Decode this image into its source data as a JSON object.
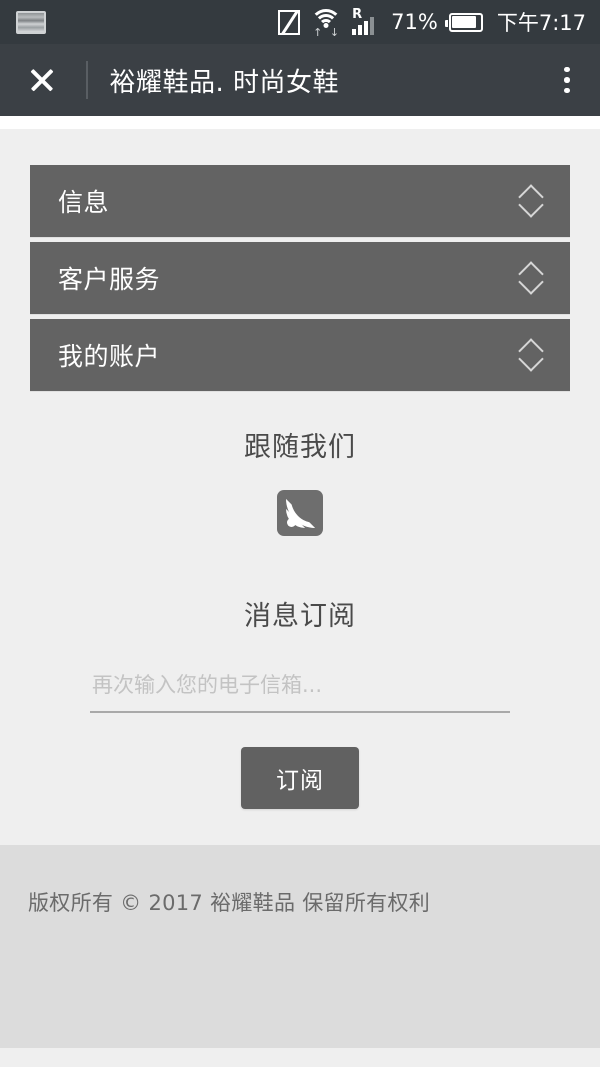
{
  "status_bar": {
    "left_icons": [
      {
        "name": "screenshot-notification-icon"
      }
    ],
    "nfc_icon": "nfc-icon",
    "wifi_icon": "wifi-icon",
    "wifi_up_arrow": "↑",
    "wifi_down_arrow": "↓",
    "signal_roaming_label": "R",
    "battery_percent": "71%",
    "time": "下午7:17"
  },
  "header": {
    "close_label": "close-icon",
    "title": "裕耀鞋品. 时尚女鞋",
    "overflow_label": "more-options-icon"
  },
  "accordion": {
    "items": [
      {
        "label": "信息"
      },
      {
        "label": "客户服务"
      },
      {
        "label": "我的账户"
      }
    ]
  },
  "follow": {
    "heading": "跟随我们",
    "social": [
      {
        "name": "rss-icon"
      }
    ]
  },
  "newsletter": {
    "heading": "消息订阅",
    "email_placeholder": "再次输入您的电子信箱...",
    "email_value": "",
    "subscribe_label": "订阅"
  },
  "footer": {
    "copyright": "版权所有 © 2017 裕耀鞋品 保留所有权利"
  },
  "colors": {
    "status_bar_bg": "#343a3f",
    "header_bg": "#3b4045",
    "page_bg": "#efefef",
    "accordion_bg": "#636363",
    "button_bg": "#616161",
    "footer_bg": "#dcdcdc",
    "text_light": "#ffffff",
    "text_dark": "#4a4a4a"
  }
}
